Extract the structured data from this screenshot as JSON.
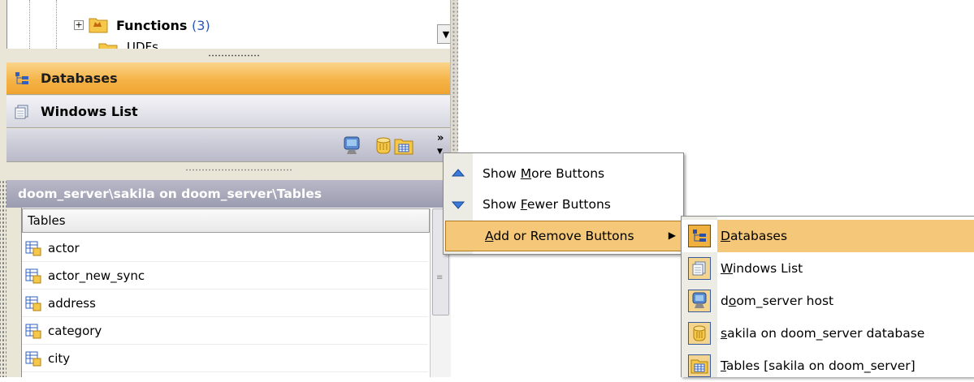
{
  "tree": {
    "functions_label": "Functions",
    "functions_count": "(3)",
    "partial_label": "UDFs"
  },
  "nav": {
    "databases_label": "Databases",
    "windows_list_label": "Windows List"
  },
  "object_panel": {
    "header": "doom_server\\sakila on doom_server\\Tables",
    "column_header": "Tables",
    "rows": [
      "actor",
      "actor_new_sync",
      "address",
      "category",
      "city"
    ]
  },
  "context_menu": {
    "items": [
      {
        "label_pre": "Show ",
        "label_u": "M",
        "label_post": "ore Buttons",
        "icon": "arrow-up-icon"
      },
      {
        "label_pre": "Show ",
        "label_u": "F",
        "label_post": "ewer Buttons",
        "icon": "arrow-down-icon"
      },
      {
        "label_pre": "",
        "label_u": "A",
        "label_post": "dd or Remove Buttons",
        "icon": "none"
      }
    ]
  },
  "submenu": {
    "items": [
      {
        "label_u": "D",
        "label_post": "atabases",
        "icon": "databases-tree-icon"
      },
      {
        "label_u": "W",
        "label_post": "indows List",
        "icon": "windows-list-icon"
      },
      {
        "label_pre": "d",
        "label_u": "o",
        "label_post": "om_server host",
        "icon": "host-monitor-icon"
      },
      {
        "label_u": "s",
        "label_post": "akila on doom_server database",
        "icon": "database-cylinder-icon"
      },
      {
        "label_u": "T",
        "label_post": "ables [sakila on doom_server]",
        "icon": "tables-icon"
      }
    ]
  },
  "colors": {
    "highlight": "#f4c878",
    "active_nav": "#f5b448",
    "header_bg": "#9c9cb0"
  }
}
